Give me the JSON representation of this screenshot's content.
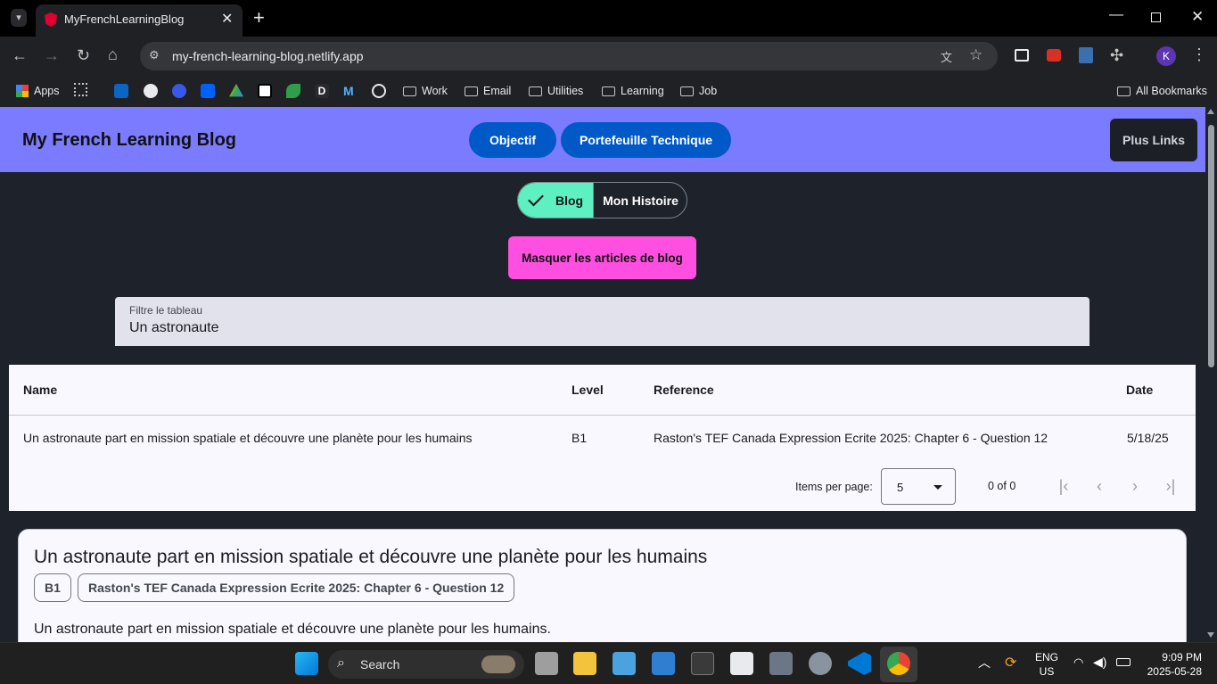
{
  "browser": {
    "tab_title": "MyFrenchLearningBlog",
    "url": "my-french-learning-blog.netlify.app",
    "bookmarks": [
      {
        "label": "Apps",
        "icon": "apps-grid-icon"
      },
      {
        "label": "Work",
        "icon": "folder-icon"
      },
      {
        "label": "Email",
        "icon": "folder-icon"
      },
      {
        "label": "Utilities",
        "icon": "folder-icon"
      },
      {
        "label": "Learning",
        "icon": "folder-icon"
      },
      {
        "label": "Job",
        "icon": "folder-icon"
      }
    ],
    "all_bookmarks": "All Bookmarks",
    "profile_initial": "K"
  },
  "header": {
    "site_title": "My French Learning Blog",
    "nav": [
      "Objectif",
      "Portefeuille Technique"
    ],
    "more_links": "Plus Links"
  },
  "toggle": {
    "blog": "Blog",
    "history": "Mon Histoire"
  },
  "hide_button": "Masquer les articles de blog",
  "filter": {
    "label": "Filtre le tableau",
    "value": "Un astronaute"
  },
  "table": {
    "columns": [
      "Name",
      "Level",
      "Reference",
      "Date"
    ],
    "rows": [
      [
        "Un astronaute part en mission spatiale et découvre une planète pour les humains",
        "B1",
        "Raston's TEF Canada Expression Ecrite 2025: Chapter 6 - Question 12",
        "5/18/25"
      ]
    ],
    "paginator": {
      "items_per_page_label": "Items per page:",
      "items_per_page": "5",
      "range": "0 of 0"
    }
  },
  "card": {
    "title": "Un astronaute part en mission spatiale et découvre une planète pour les humains",
    "chips": [
      "B1",
      "Raston's TEF Canada Expression Ecrite 2025: Chapter 6 - Question 12"
    ],
    "body": "Un astronaute part en mission spatiale et découvre une planète pour les humains."
  },
  "taskbar": {
    "search": "Search",
    "lang1": "ENG",
    "lang2": "US",
    "time": "9:09 PM",
    "date": "2025-05-28"
  }
}
